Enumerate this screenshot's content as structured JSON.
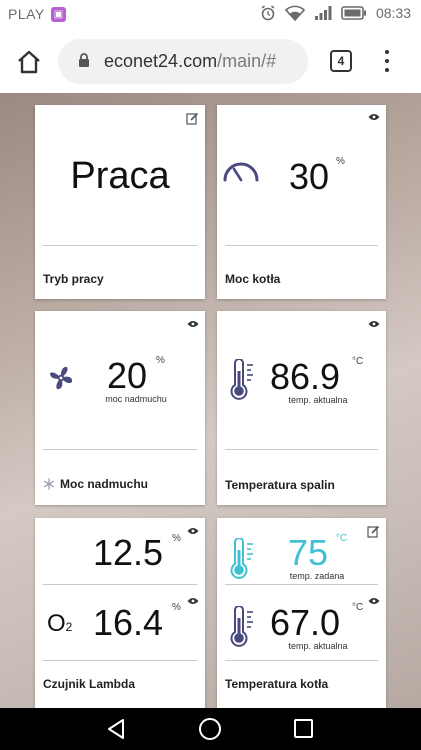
{
  "status_bar": {
    "carrier": "PLAY",
    "time": "08:33",
    "icons": [
      "app-notification-icon",
      "alarm-icon",
      "wifi-icon",
      "signal-icon",
      "battery-icon"
    ]
  },
  "browser": {
    "url_host": "econet24.com",
    "url_path": "/main/#",
    "tab_count": "4"
  },
  "tiles": {
    "tryb_pracy": {
      "value": "Praca",
      "title": "Tryb pracy",
      "corner_icon": "edit-icon"
    },
    "moc_kotla": {
      "value": "30",
      "unit": "%",
      "title": "Moc kotła",
      "icon": "gauge-icon",
      "corner_icon": "eye-icon"
    },
    "moc_nadmuchu": {
      "value": "20",
      "unit": "%",
      "sub": "moc nadmuchu",
      "title": "Moc nadmuchu",
      "icon": "fan-icon",
      "corner_icon": "eye-icon"
    },
    "temperatura_spalin": {
      "value": "86.9",
      "unit": "°C",
      "sub": "temp. aktualna",
      "title": "Temperatura spalin",
      "icon": "thermometer-icon",
      "corner_icon": "eye-icon"
    },
    "czujnik_lambda": {
      "value1": "12.5",
      "unit1": "%",
      "o2_label": "O",
      "o2_sub": "2",
      "value2": "16.4",
      "unit2": "%",
      "title": "Czujnik Lambda"
    },
    "temperatura_kotla": {
      "value_set": "75",
      "unit_set": "°C",
      "sub_set": "temp. zadana",
      "value_actual": "67.0",
      "unit_actual": "°C",
      "sub_actual": "temp. aktualna",
      "title": "Temperatura kotła",
      "accent": "#3ec1d3"
    }
  },
  "colors": {
    "icon_purple": "#4a4a7e",
    "accent_cyan": "#3ec1d3"
  }
}
